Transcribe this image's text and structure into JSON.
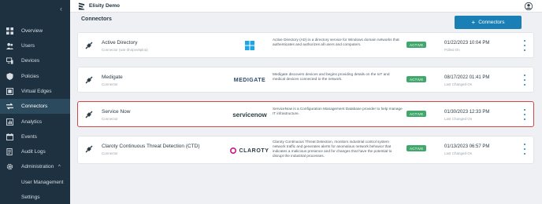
{
  "app": {
    "title": "Elisity Demo"
  },
  "page": {
    "title": "Connectors",
    "add_button_label": "Connectors"
  },
  "sidebar": {
    "collapse_glyph": "‹",
    "items": [
      {
        "label": "Overview",
        "icon": "grid-icon",
        "active": false
      },
      {
        "label": "Users",
        "icon": "users-icon",
        "active": false
      },
      {
        "label": "Devices",
        "icon": "devices-icon",
        "active": false
      },
      {
        "label": "Policies",
        "icon": "shield-icon",
        "active": false
      },
      {
        "label": "Virtual Edges",
        "icon": "edge-icon",
        "active": false
      },
      {
        "label": "Connectors",
        "icon": "connectors-icon",
        "active": true
      },
      {
        "label": "Analytics",
        "icon": "analytics-icon",
        "active": false
      },
      {
        "label": "Events",
        "icon": "events-icon",
        "active": false
      },
      {
        "label": "Audit Logs",
        "icon": "audit-icon",
        "active": false
      },
      {
        "label": "Administration",
        "icon": "gear-icon",
        "active": false,
        "caret": "^"
      },
      {
        "label": "User Management",
        "icon": "",
        "active": false
      },
      {
        "label": "Settings",
        "icon": "",
        "active": false
      }
    ]
  },
  "connectors": [
    {
      "name": "Active Directory",
      "sub": "Connector (win-3h4pvv9plna)",
      "brand": "windows-logo",
      "description": "Active Directory (AD) is a directory service for Windows domain networks that authenticates and authorizes all users and computers.",
      "status": "ACTIVE",
      "date": "01/22/2023 10:04 PM",
      "date_label": "Polled On",
      "selected": false
    },
    {
      "name": "Medigate",
      "sub": "Connector",
      "brand": "medigate-logo",
      "brand_text": "MEDIGATE",
      "description": "Medigate discovers devices and begins providing details on the IoT and medical devices connected to the network.",
      "status": "ACTIVE",
      "date": "08/17/2022 01:41 PM",
      "date_label": "Last Changed On",
      "selected": false
    },
    {
      "name": "Service Now",
      "sub": "Connector",
      "brand": "servicenow-logo",
      "brand_text": "servicenow",
      "description": "ServiceNow is a Configuration Management Database provider to help manage IT infrastructure.",
      "status": "ACTIVE",
      "date": "01/30/2023 12:33 PM",
      "date_label": "Last Changed On",
      "selected": true
    },
    {
      "name": "Claroty Continuous Threat Detection (CTD)",
      "sub": "Connector",
      "brand": "claroty-logo",
      "brand_text": "CLAROTY",
      "description": "Claroty Continuous Threat Detection, monitors industrial control system network traffic and generates alerts for anomalous network behavior that indicates a malicious presence and for changes that have the potential to disrupt the industrial processes.",
      "status": "ACTIVE",
      "date": "01/13/2023 06:57 PM",
      "date_label": "Last Changed On",
      "selected": false
    }
  ],
  "colors": {
    "sidebar": "#1d3140",
    "accent": "#1a7fb4",
    "active_badge": "#3fa86a",
    "selection": "#d64545"
  }
}
